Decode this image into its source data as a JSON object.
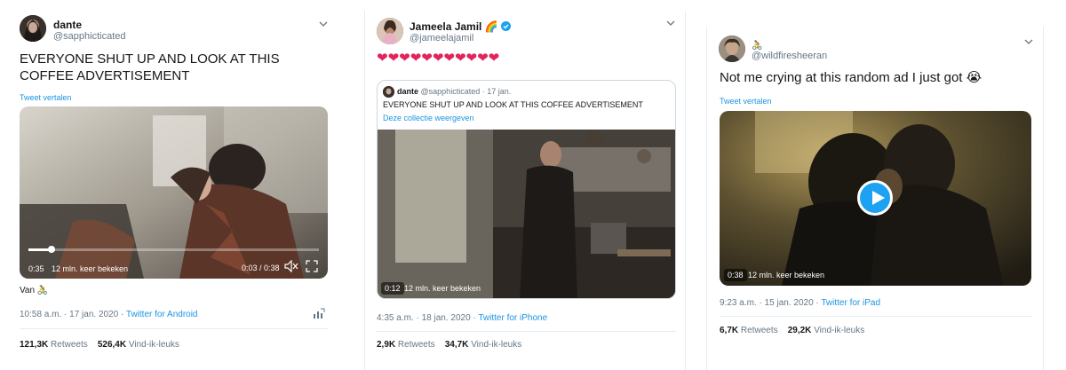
{
  "tweets": [
    {
      "author_name": "dante",
      "author_handle": "@sapphicticated",
      "text": "EVERYONE SHUT UP AND LOOK AT THIS COFFEE ADVERTISEMENT",
      "translate_link": "Tweet vertalen",
      "video": {
        "elapsed": "0:35",
        "views": "12 mln. keer bekeken",
        "progress": "0:03 / 0:38",
        "progress_fraction": 0.08
      },
      "from_label": "Van",
      "timestamp": "10:58 a.m. · 17 jan. 2020 · ",
      "source": "Twitter for Android",
      "retweets_count": "121,3K",
      "retweets_label": "Retweets",
      "likes_count": "526,4K",
      "likes_label": "Vind-ik-leuks"
    },
    {
      "author_name": "Jameela Jamil",
      "author_emoji": "🌈",
      "author_handle": "@jameelajamil",
      "hearts": "❤❤❤❤❤❤❤❤❤❤❤",
      "quoted": {
        "author_name": "dante",
        "author_handle": "@sapphicticated",
        "date": "· 17 jan.",
        "text": "EVERYONE SHUT UP AND LOOK AT THIS COFFEE ADVERTISEMENT",
        "link": "Deze collectie weergeven",
        "video_elapsed": "0:12",
        "video_views": "12 mln. keer bekeken"
      },
      "timestamp": "4:35 a.m. · 18 jan. 2020 · ",
      "source": "Twitter for iPhone",
      "retweets_count": "2,9K",
      "retweets_label": "Retweets",
      "likes_count": "34,7K",
      "likes_label": "Vind-ik-leuks"
    },
    {
      "author_handle": "@wildfiresheeran",
      "text": "Not me crying at this random ad I just got 😭",
      "translate_link": "Tweet vertalen",
      "video": {
        "elapsed": "0:38",
        "views": "12 mln. keer bekeken"
      },
      "timestamp": "9:23 a.m. · 15 jan. 2020 · ",
      "source": "Twitter for iPad",
      "retweets_count": "6,7K",
      "retweets_label": "Retweets",
      "likes_count": "29,2K",
      "likes_label": "Vind-ik-leuks"
    }
  ],
  "colors": {
    "accent": "#1b95e0",
    "text": "#14171a",
    "muted": "#657786",
    "heart": "#e0245e"
  }
}
